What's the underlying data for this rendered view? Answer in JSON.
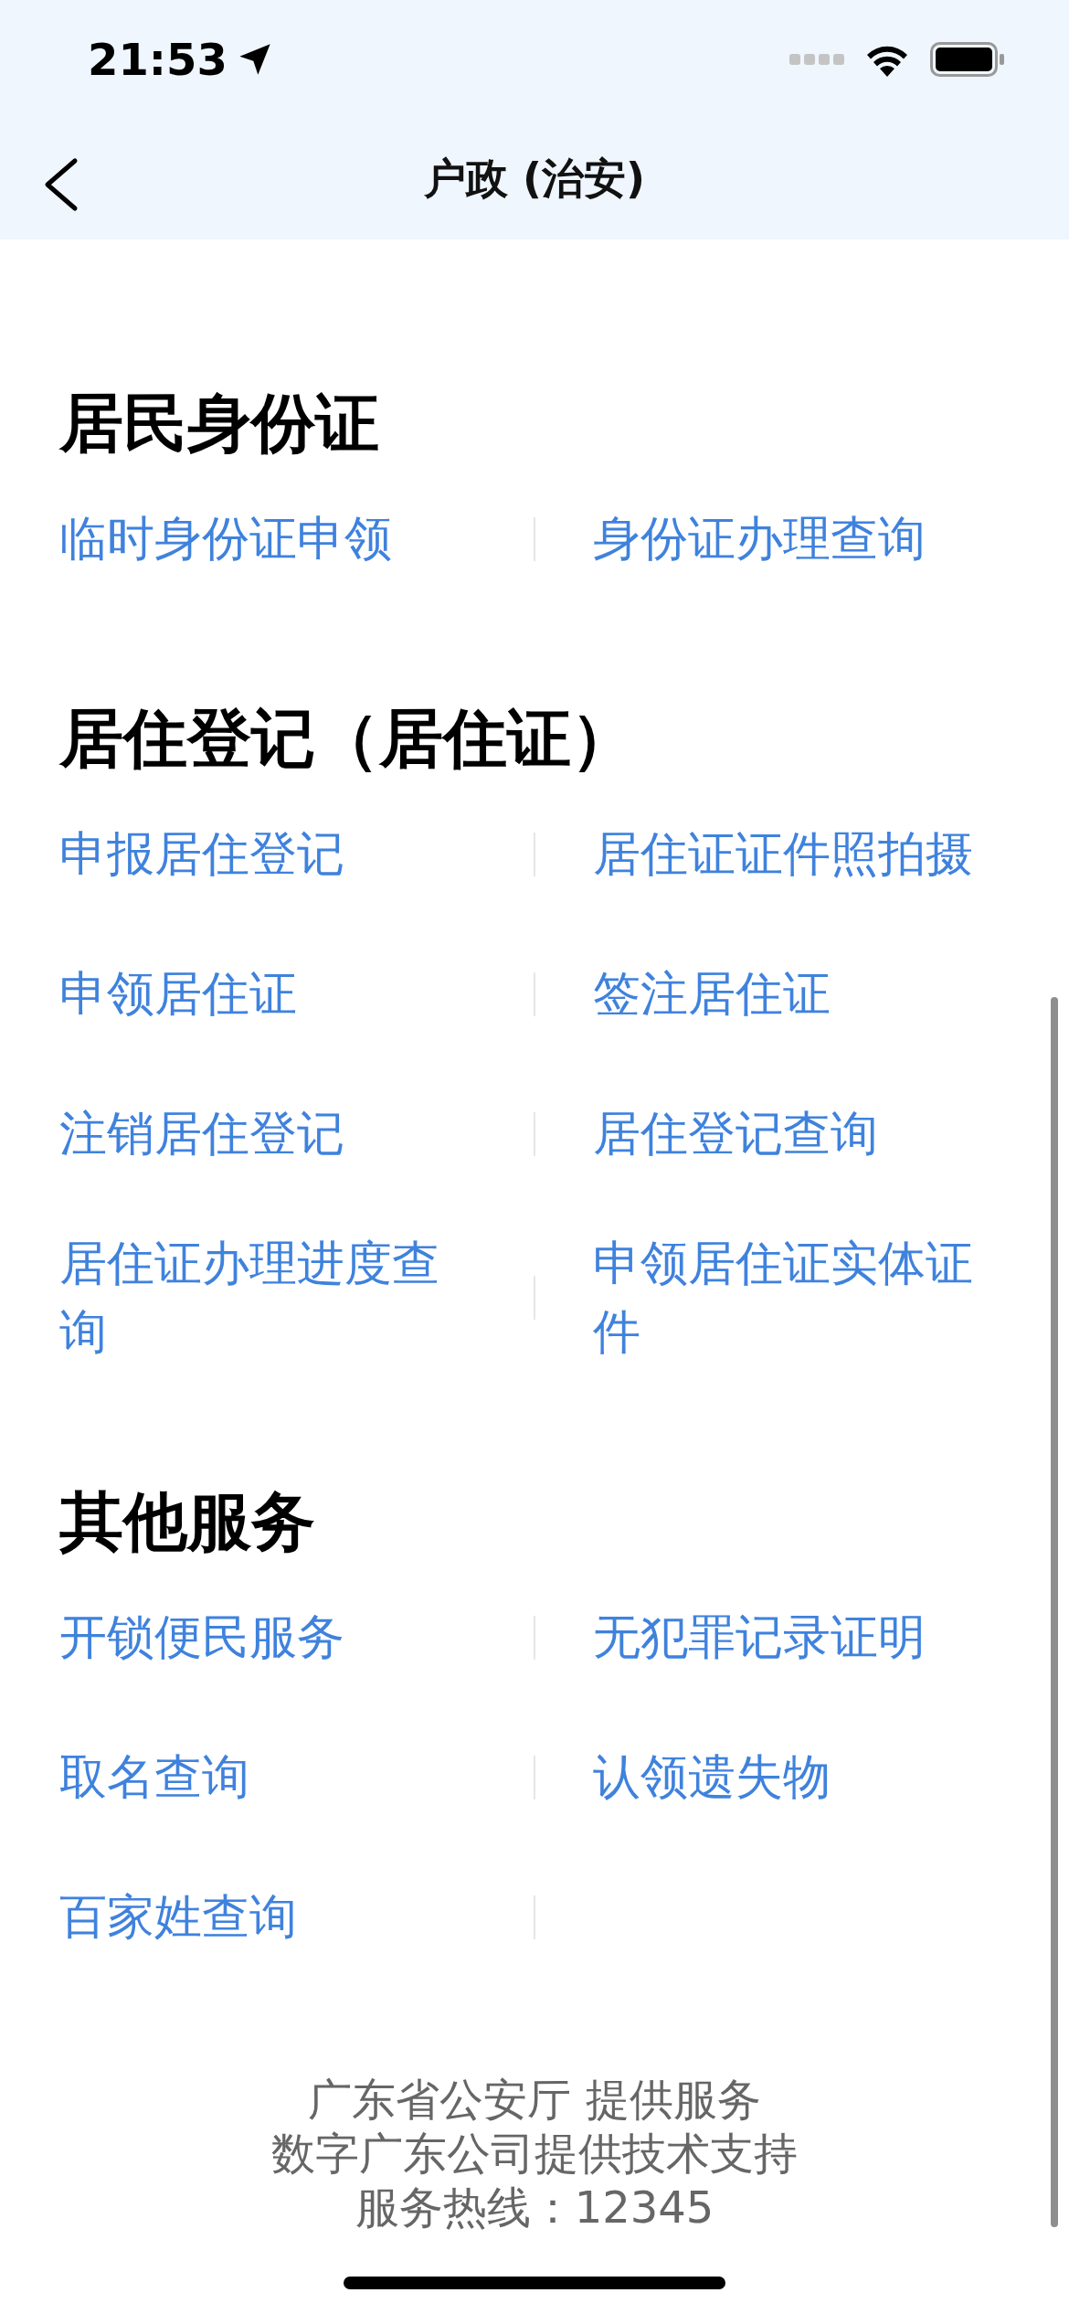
{
  "status_bar": {
    "time": "21:53"
  },
  "nav": {
    "title": "户政 (治安)"
  },
  "sections": [
    {
      "title": "居民身份证",
      "items": [
        "临时身份证申领",
        "身份证办理查询"
      ]
    },
    {
      "title": "居住登记（居住证）",
      "items": [
        "申报居住登记",
        "居住证证件照拍摄",
        "申领居住证",
        "签注居住证",
        "注销居住登记",
        "居住登记查询",
        "居住证办理进度查询",
        "申领居住证实体证件"
      ]
    },
    {
      "title": "其他服务",
      "items": [
        "开锁便民服务",
        "无犯罪记录证明",
        "取名查询",
        "认领遗失物",
        "百家姓查询"
      ]
    }
  ],
  "footer": {
    "lines": [
      "广东省公安厅 提供服务",
      "数字广东公司提供技术支持",
      "服务热线：12345"
    ]
  }
}
